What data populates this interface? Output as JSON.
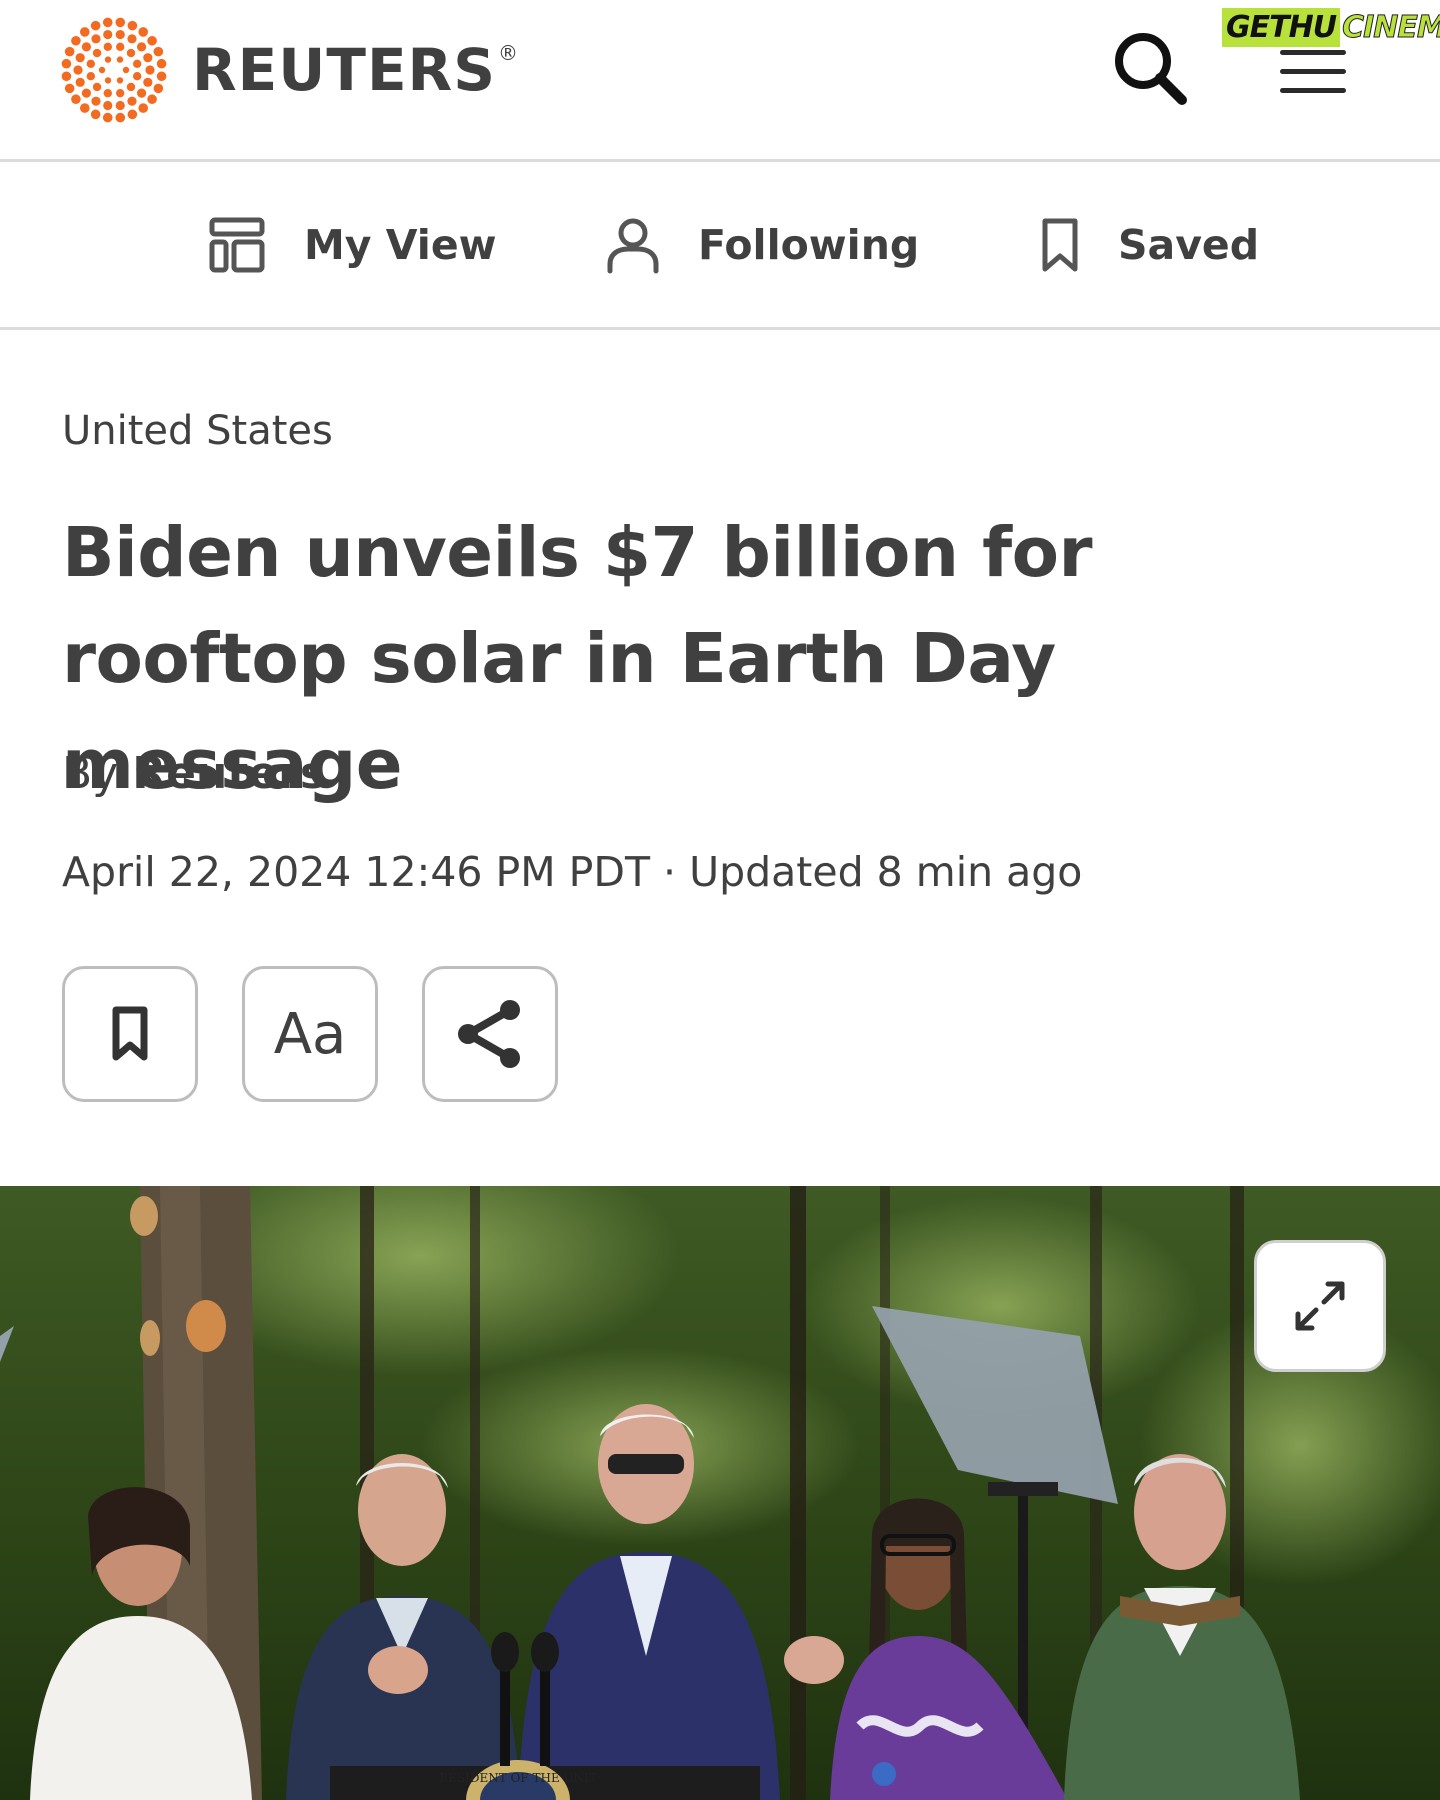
{
  "header": {
    "brand": "REUTERS",
    "registered_mark": "®",
    "search_icon": "search-icon",
    "menu_icon": "hamburger-menu-icon"
  },
  "watermark": {
    "part1": "GETHU",
    "part2": "CINEMA"
  },
  "subnav": {
    "items": [
      {
        "label": "My View",
        "icon": "layout-icon"
      },
      {
        "label": "Following",
        "icon": "person-icon"
      },
      {
        "label": "Saved",
        "icon": "bookmark-icon"
      }
    ]
  },
  "article": {
    "section": "United States",
    "headline": "Biden unveils $7 billion for rooftop solar in Earth Day message",
    "byline_prefix": "By",
    "author": "Reuters",
    "dateline": "April 22, 2024 12:46 PM PDT · Updated 8 min ago",
    "tools": {
      "bookmark_icon": "bookmark-icon",
      "text_size_label": "Aa",
      "share_icon": "share-icon"
    },
    "hero_image": {
      "description_icon": "photo",
      "expand_icon": "expand-icon",
      "podium_seal_text": "RESIDENT OF THE UNIT"
    }
  },
  "colors": {
    "brand_orange": "#f26b21",
    "text": "#404040",
    "divider": "#dcdcdc",
    "watermark_green": "#b8e23b"
  }
}
